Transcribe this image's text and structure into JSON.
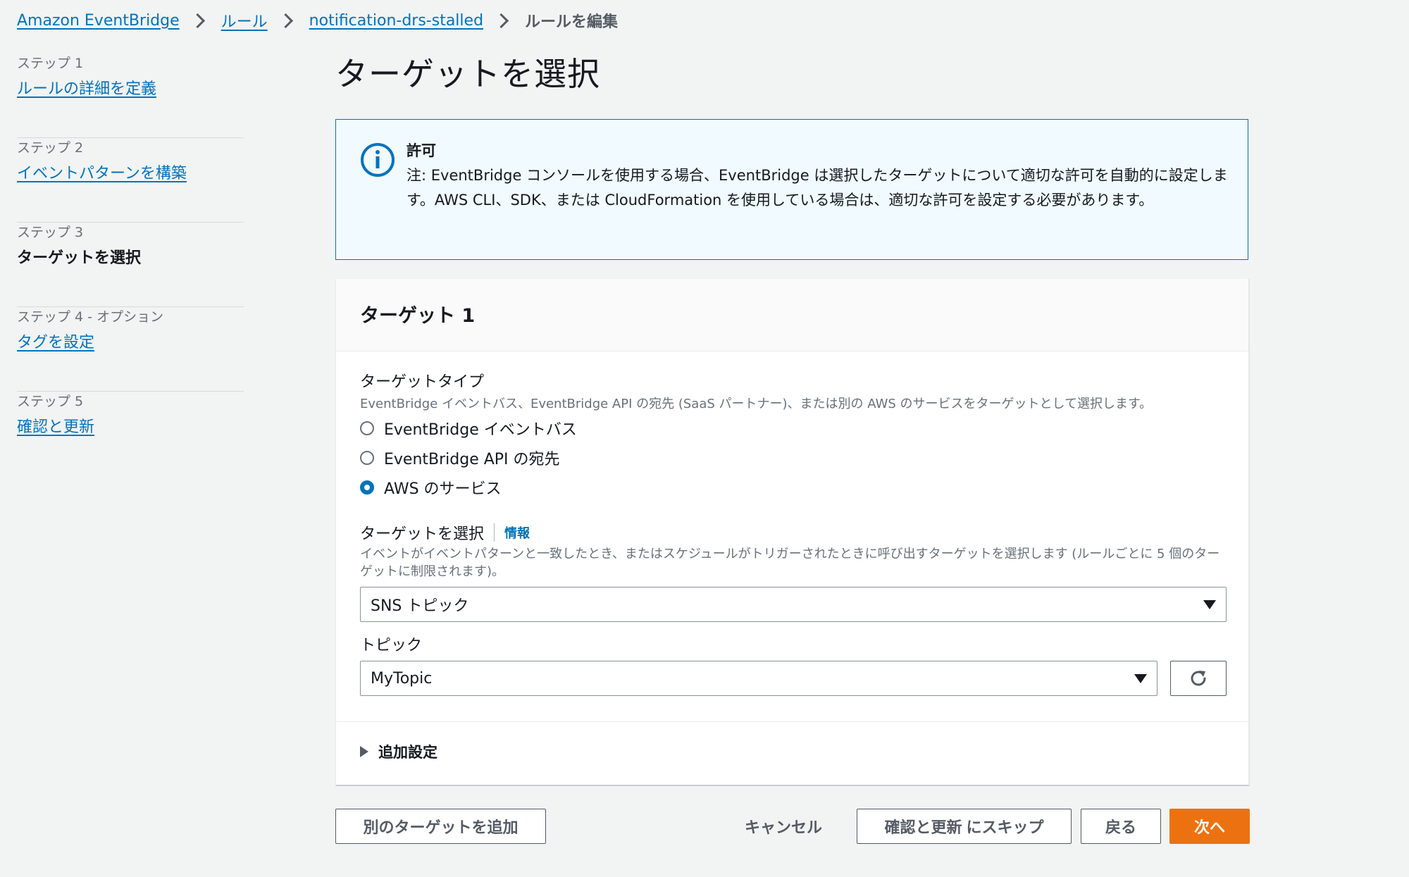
{
  "breadcrumb": {
    "items": [
      "Amazon EventBridge",
      "ルール",
      "notification-drs-stalled"
    ],
    "current": "ルールを編集"
  },
  "steps": [
    {
      "label": "ステップ 1",
      "title": "ルールの詳細を定義"
    },
    {
      "label": "ステップ 2",
      "title": "イベントパターンを構築"
    },
    {
      "label": "ステップ 3",
      "title": "ターゲットを選択"
    },
    {
      "label": "ステップ 4 - オプション",
      "title": "タグを設定"
    },
    {
      "label": "ステップ 5",
      "title": "確認と更新"
    }
  ],
  "page_title": "ターゲットを選択",
  "alert": {
    "title": "許可",
    "body": "注: EventBridge コンソールを使用する場合、EventBridge は選択したターゲットについて適切な許可を自動的に設定します。AWS CLI、SDK、または CloudFormation を使用している場合は、適切な許可を設定する必要があります。"
  },
  "target": {
    "title": "ターゲット 1",
    "type_label": "ターゲットタイプ",
    "type_desc": "EventBridge イベントバス、EventBridge API の宛先 (SaaS パートナー)、または別の AWS のサービスをターゲットとして選択します。",
    "options": [
      "EventBridge イベントバス",
      "EventBridge API の宛先",
      "AWS のサービス"
    ],
    "selected_option": "AWS のサービス",
    "select_label": "ターゲットを選択",
    "info": "情報",
    "select_desc": "イベントがイベントパターンと一致したとき、またはスケジュールがトリガーされたときに呼び出すターゲットを選択します (ルールごとに 5 個のターゲットに制限されます)。",
    "select_value": "SNS トピック",
    "topic_label": "トピック",
    "topic_value": "MyTopic",
    "additional": "追加設定"
  },
  "buttons": {
    "add_target": "別のターゲットを追加",
    "cancel": "キャンセル",
    "skip": "確認と更新 にスキップ",
    "back": "戻る",
    "next": "次へ"
  },
  "colors": {
    "link": "#0073bb",
    "primary": "#ec7211",
    "alert_bg": "#f1faff"
  }
}
